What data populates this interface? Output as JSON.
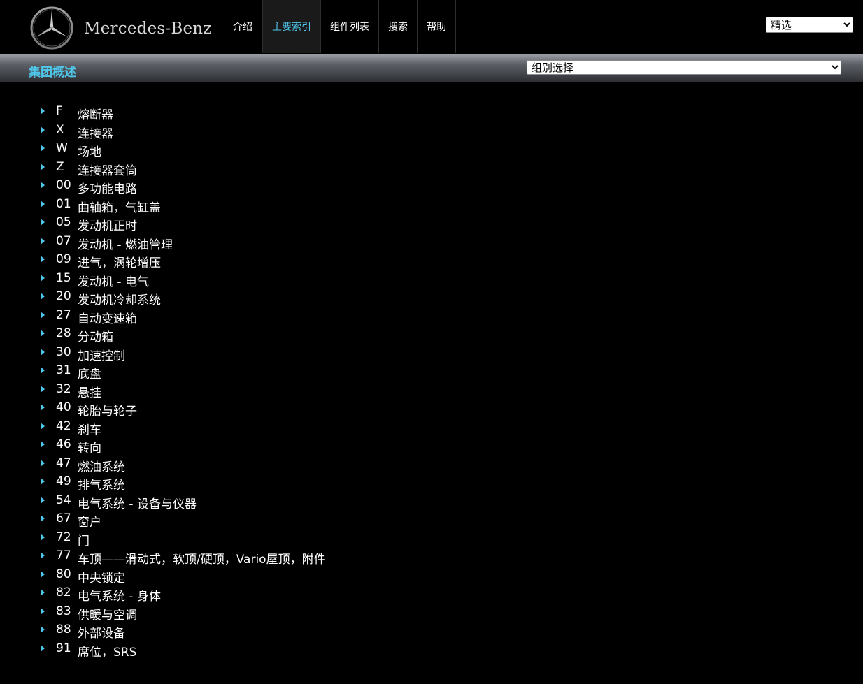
{
  "header": {
    "brand": "Mercedes-Benz",
    "nav": [
      {
        "label": "介绍"
      },
      {
        "label": "主要索引"
      },
      {
        "label": "组件列表"
      },
      {
        "label": "搜索"
      },
      {
        "label": "帮助"
      }
    ],
    "active_nav": "主要索引",
    "filter_select": {
      "selected": "精选"
    }
  },
  "subbar": {
    "title": "集团概述",
    "group_select": {
      "selected": "组别选择"
    }
  },
  "colors": {
    "accent": "#4fc7ea",
    "background": "#000000"
  },
  "icons": {
    "list_bullet": "arrow-right-icon",
    "logo": "mercedes-star-icon"
  },
  "groups": [
    {
      "code": "F",
      "name": "熔断器"
    },
    {
      "code": "X",
      "name": "连接器"
    },
    {
      "code": "W",
      "name": "场地"
    },
    {
      "code": "Z",
      "name": "连接器套筒"
    },
    {
      "code": "00",
      "name": "多功能电路"
    },
    {
      "code": "01",
      "name": "曲轴箱，气缸盖"
    },
    {
      "code": "05",
      "name": "发动机正时"
    },
    {
      "code": "07",
      "name": "发动机 - 燃油管理"
    },
    {
      "code": "09",
      "name": "进气，涡轮增压"
    },
    {
      "code": "15",
      "name": "发动机 - 电气"
    },
    {
      "code": "20",
      "name": "发动机冷却系统"
    },
    {
      "code": "27",
      "name": "自动变速箱"
    },
    {
      "code": "28",
      "name": "分动箱"
    },
    {
      "code": "30",
      "name": "加速控制"
    },
    {
      "code": "31",
      "name": "底盘"
    },
    {
      "code": "32",
      "name": "悬挂"
    },
    {
      "code": "40",
      "name": "轮胎与轮子"
    },
    {
      "code": "42",
      "name": "刹车"
    },
    {
      "code": "46",
      "name": "转向"
    },
    {
      "code": "47",
      "name": "燃油系统"
    },
    {
      "code": "49",
      "name": "排气系统"
    },
    {
      "code": "54",
      "name": "电气系统 - 设备与仪器"
    },
    {
      "code": "67",
      "name": "窗户"
    },
    {
      "code": "72",
      "name": "门"
    },
    {
      "code": "77",
      "name": "车顶——滑动式，软顶/硬顶，Vario屋顶，附件"
    },
    {
      "code": "80",
      "name": "中央锁定"
    },
    {
      "code": "82",
      "name": "电气系统 - 身体"
    },
    {
      "code": "83",
      "name": "供暖与空调"
    },
    {
      "code": "88",
      "name": "外部设备"
    },
    {
      "code": "91",
      "name": "席位，SRS"
    }
  ]
}
